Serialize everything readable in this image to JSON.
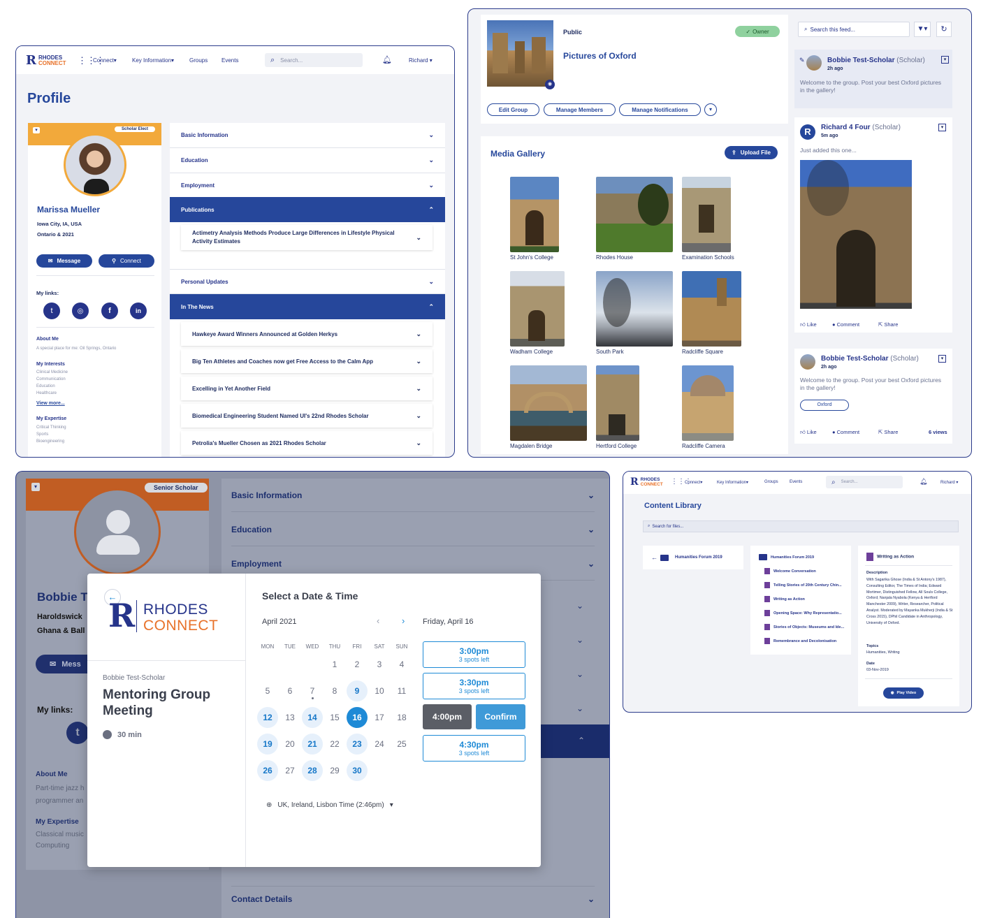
{
  "brand": {
    "line1": "RHODES",
    "line2": "CONNECT",
    "navy": "#26348a",
    "orange": "#e8722a",
    "blue": "#26479b"
  },
  "nav": {
    "connect": "Connect",
    "key_information": "Key Information",
    "groups": "Groups",
    "events": "Events",
    "search_placeholder": "Search...",
    "user": "Richard"
  },
  "profile": {
    "page_title": "Profile",
    "badge": "Scholar Elect",
    "name": "Marissa Mueller",
    "location": "Iowa City, IA, USA",
    "cohort": "Ontario & 2021",
    "message_label": "Message",
    "connect_label": "Connect",
    "my_links_label": "My links:",
    "about_label": "About Me",
    "about_text": "A special place for me: Oil Springs, Ontario",
    "interests_label": "My Interests",
    "interests": [
      "Clinical Medicine",
      "Communication",
      "Education",
      "Healthcare"
    ],
    "view_more": "View more...",
    "expertise_label": "My Expertise",
    "expertise": [
      "Critical Thinking",
      "Sports",
      "Bioengineering"
    ],
    "sections": [
      "Basic Information",
      "Education",
      "Employment",
      "Publications",
      "Personal Updates",
      "In The News"
    ],
    "publication": "Actimetry Analysis Methods Produce Large Differences in Lifestyle Physical Activity Estimates",
    "news": [
      "Hawkeye Award Winners Announced at Golden Herkys",
      "Big Ten Athletes and Coaches now get Free Access to the Calm App",
      "Excelling in Yet Another Field",
      "Biomedical Engineering Student Named UI's 22nd Rhodes Scholar",
      "Petrolia's Mueller Chosen as 2021 Rhodes Scholar"
    ]
  },
  "group": {
    "visibility": "Public",
    "owner_badge": "Owner",
    "title": "Pictures of Oxford",
    "edit_group": "Edit Group",
    "manage_members": "Manage Members",
    "manage_notifications": "Manage Notifications",
    "gallery_title": "Media Gallery",
    "upload_label": "Upload File",
    "photos": [
      "St John's College",
      "Rhodes House",
      "Examination Schools",
      "Wadham College",
      "South Park",
      "Radcliffe Square",
      "Magdalen Bridge",
      "Hertford College",
      "Radcliffe Camera"
    ]
  },
  "feed": {
    "search_placeholder": "Search this feed...",
    "posts": [
      {
        "author": "Bobbie Test-Scholar",
        "role": "(Scholar)",
        "time": "2h ago",
        "text": "Welcome to the group. Post your best Oxford pictures in the gallery!"
      },
      {
        "author": "Richard 4 Four",
        "role": "(Scholar)",
        "time": "5m ago",
        "text": "Just added this one..."
      },
      {
        "author": "Bobbie Test-Scholar",
        "role": "(Scholar)",
        "time": "2h ago",
        "text": "Welcome to the group. Post your best Oxford pictures in the gallery!",
        "tag": "Oxford",
        "views": "6 views"
      }
    ],
    "like": "Like",
    "comment": "Comment",
    "share": "Share"
  },
  "booking": {
    "badge": "Senior Scholar",
    "bg_name": "Bobbie T",
    "bg_loc1": "Haroldswick",
    "bg_loc2": "Ghana & Ball",
    "bg_message": "Mess",
    "bg_links": "My links:",
    "bg_about_label": "About Me",
    "bg_about_text1": "Part-time jazz h",
    "bg_about_text2": "programmer an",
    "bg_expertise_label": "My Expertise",
    "bg_expertise": [
      "Classical music",
      "Computing"
    ],
    "bg_sections": [
      "Basic Information",
      "Education",
      "Employment"
    ],
    "bg_contact": "Contact Details",
    "host": "Bobbie Test-Scholar",
    "event_title": "Mentoring Group Meeting",
    "duration": "30 min",
    "heading": "Select a Date & Time",
    "month": "April 2021",
    "selected_day": "Friday, April 16",
    "weekdays": [
      "MON",
      "TUE",
      "WED",
      "THU",
      "FRI",
      "SAT",
      "SUN"
    ],
    "slots": [
      {
        "time": "3:00pm",
        "spots": "3 spots left"
      },
      {
        "time": "3:30pm",
        "spots": "3 spots left"
      },
      {
        "time": "4:00pm"
      },
      {
        "time": "4:30pm",
        "spots": "3 spots left"
      }
    ],
    "confirm": "Confirm",
    "timezone": "UK, Ireland, Lisbon Time (2:46pm)"
  },
  "library": {
    "title": "Content Library",
    "search_placeholder": "Search for files...",
    "back_folder": "Humanities Forum 2019",
    "folder": "Humanities Forum 2019",
    "files": [
      "Welcome Conversation",
      "Telling Stories of 20th Century Chin...",
      "Writing as Action",
      "Opening Space: Why Representatio...",
      "Stories of Objects: Museums and Ide...",
      "Remembrance and Decolonisation"
    ],
    "detail_title": "Writing as Action",
    "description_label": "Description",
    "description": "With Sagarika Ghose (India & St Antony's 1987), Consulting Editor, The Times of India; Edward Mortimer, Distinguished Fellow, All Souls College, Oxford; Nanjala Nyabola (Kenya & Hertford Manchester 2009), Writer, Researcher, Political Analyst. Moderated by Mayanka Mukherji (India & St Cross 2015), DPhil Candidate in Anthropology, University of Oxford.",
    "topics_label": "Topics",
    "topics": "Humanities, Writing",
    "date_label": "Date",
    "date": "03-Nov-2019",
    "play": "Play Video"
  }
}
